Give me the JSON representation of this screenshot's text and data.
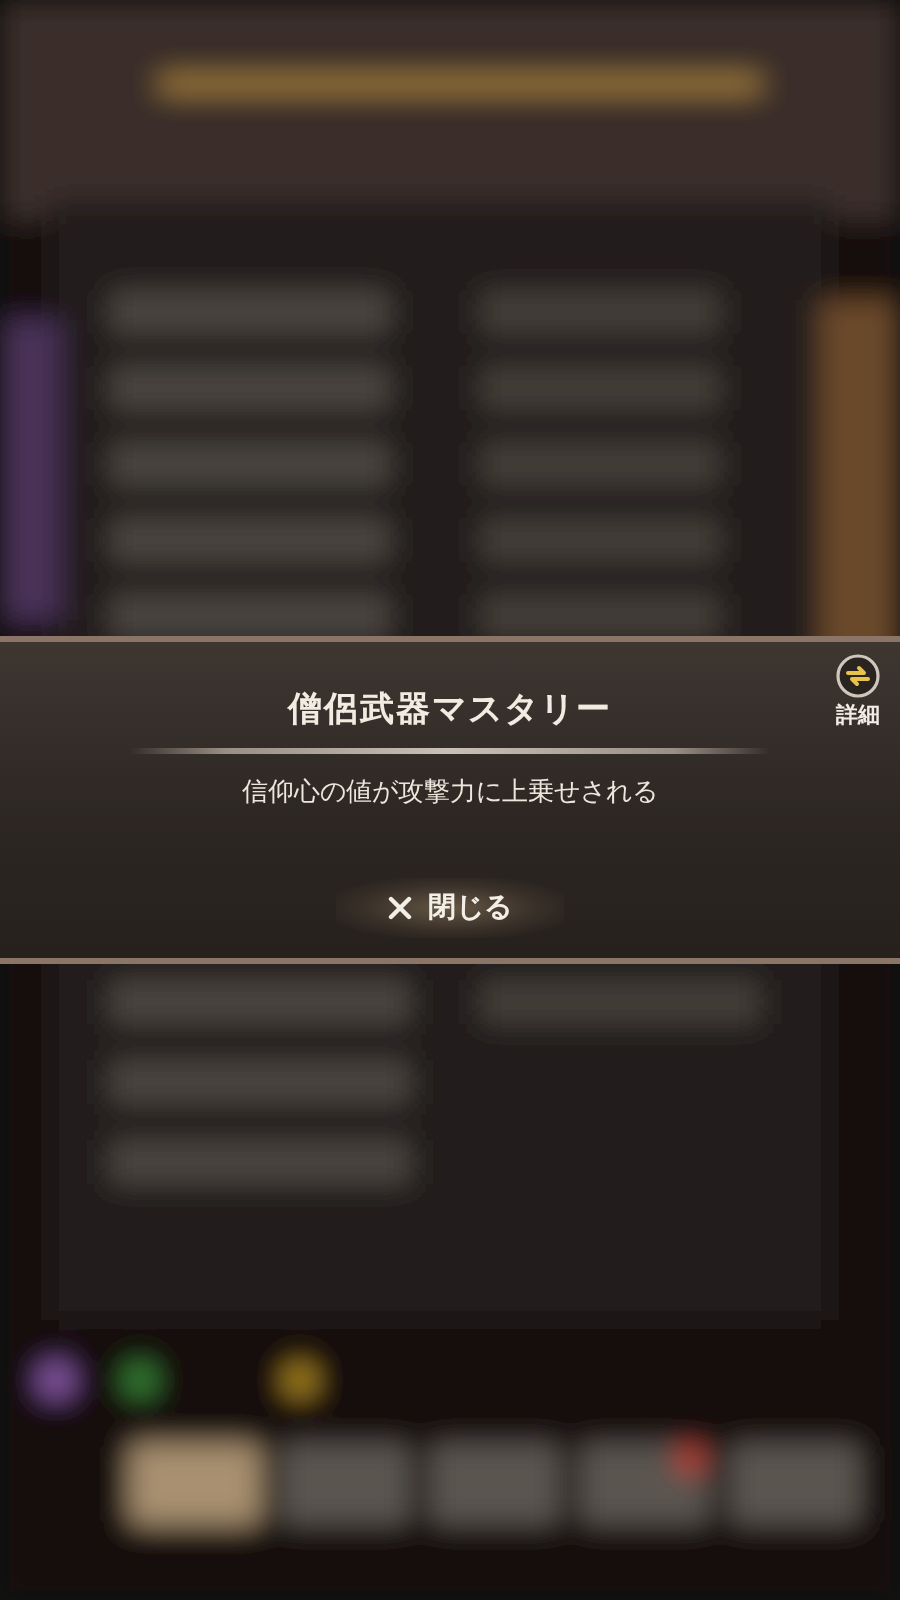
{
  "dialog": {
    "title": "僧侶武器マスタリー",
    "description": "信仰心の値が攻撃力に上乗せされる",
    "detail_button": {
      "label": "詳細"
    },
    "close_button": {
      "label": "閉じる"
    }
  }
}
